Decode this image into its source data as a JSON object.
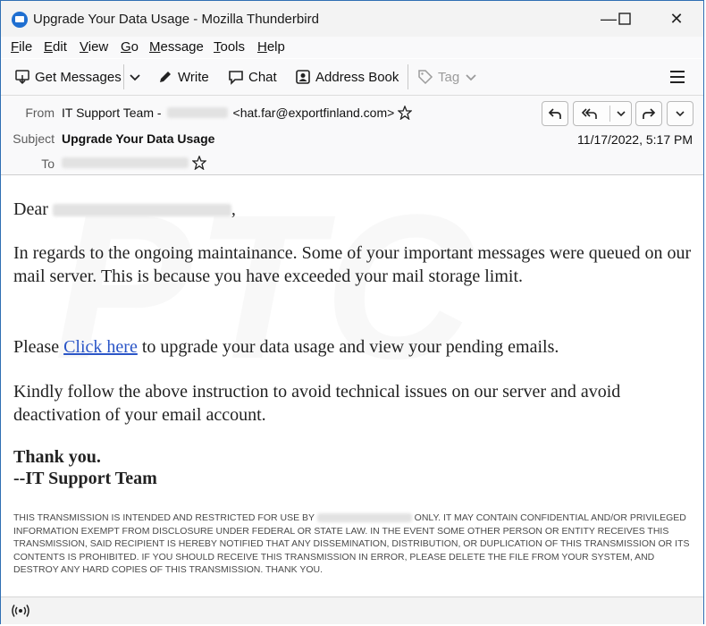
{
  "window": {
    "title": "Upgrade Your Data Usage - Mozilla Thunderbird",
    "minimize": "—",
    "maximize": "☐",
    "close": "✕"
  },
  "menu": {
    "items": [
      {
        "first": "F",
        "rest": "ile"
      },
      {
        "first": "E",
        "rest": "dit"
      },
      {
        "first": "V",
        "rest": "iew"
      },
      {
        "first": "G",
        "rest": "o"
      },
      {
        "first": "M",
        "rest": "essage"
      },
      {
        "first": "T",
        "rest": "ools"
      },
      {
        "first": "H",
        "rest": "elp"
      }
    ]
  },
  "toolbar": {
    "get_messages": "Get Messages",
    "write": "Write",
    "chat": "Chat",
    "address_book": "Address Book",
    "tag": "Tag",
    "icons": {
      "get_messages": "download-icon",
      "write": "pencil-icon",
      "chat": "chat-icon",
      "address_book": "address-book-icon",
      "tag": "tag-icon",
      "menu": "hamburger-icon"
    }
  },
  "header": {
    "from_label": "From",
    "from_name": "IT Support Team -",
    "from_email": "<hat.far@exportfinland.com>",
    "subject_label": "Subject",
    "subject": "Upgrade Your Data Usage",
    "to_label": "To",
    "date": "11/17/2022, 5:17 PM"
  },
  "body": {
    "greeting": "Dear",
    "greeting_suffix": ",",
    "para1": "In regards to the ongoing maintainance. Some of your important messages were queued on our mail server. This is because you have exceeded your mail storage limit.",
    "para2_before": "Please ",
    "para2_link": "Click here",
    "para2_after": " to upgrade your data usage and view your pending emails.",
    "para3": "Kindly follow the above instruction to avoid technical issues on our server and avoid deactivation of your email account.",
    "sign1": "Thank you.",
    "sign2": "--IT Support Team",
    "disclaimer_before": "THIS TRANSMISSION IS INTENDED AND RESTRICTED FOR USE BY",
    "disclaimer_after": "ONLY. IT MAY CONTAIN CONFIDENTIAL AND/OR PRIVILEGED INFORMATION EXEMPT FROM DISCLOSURE UNDER FEDERAL OR STATE LAW. IN THE EVENT SOME OTHER PERSON OR ENTITY RECEIVES THIS TRANSMISSION, SAID RECIPIENT IS HEREBY NOTIFIED THAT ANY DISSEMINATION, DISTRIBUTION, OR DUPLICATION OF THIS TRANSMISSION OR ITS CONTENTS IS PROHIBITED. IF YOU SHOULD RECEIVE THIS TRANSMISSION IN ERROR, PLEASE DELETE THE FILE FROM YOUR SYSTEM, AND DESTROY ANY HARD COPIES OF THIS TRANSMISSION. THANK YOU.",
    "watermark": "PTC"
  },
  "colors": {
    "accent": "#1f6fd1",
    "link": "#2a55c7",
    "frame": "#2f6fb3"
  }
}
